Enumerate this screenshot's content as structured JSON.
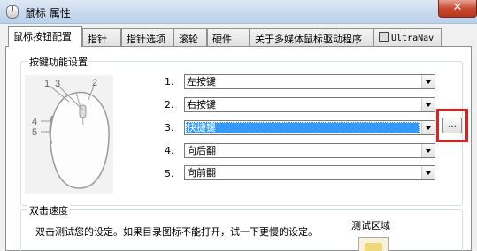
{
  "window": {
    "title": "鼠标 属性",
    "close_glyph": "✕"
  },
  "tabs": [
    {
      "label": "鼠标按钮配置"
    },
    {
      "label": "指针"
    },
    {
      "label": "指针选项"
    },
    {
      "label": "滚轮"
    },
    {
      "label": "硬件"
    },
    {
      "label": "关于多媒体鼠标驱动程序"
    },
    {
      "label": "UltraNav"
    }
  ],
  "button_config": {
    "group_title": "按键功能设置",
    "mouse_callouts": [
      "1",
      "2",
      "3",
      "4",
      "5"
    ],
    "rows": [
      {
        "num": "1.",
        "value": "左按键"
      },
      {
        "num": "2.",
        "value": "右按键"
      },
      {
        "num": "3.",
        "value": "快捷键"
      },
      {
        "num": "4.",
        "value": "向后翻"
      },
      {
        "num": "5.",
        "value": "向前翻"
      }
    ],
    "ellipsis_label": "..."
  },
  "double_click": {
    "group_title": "双击速度",
    "description": "双击测试您的设定。如果目录图标不能打开，试一下更慢的设定。",
    "test_area_label": "测试区域"
  },
  "colors": {
    "selection": "#3399ff",
    "highlight_border": "#e0201c"
  }
}
